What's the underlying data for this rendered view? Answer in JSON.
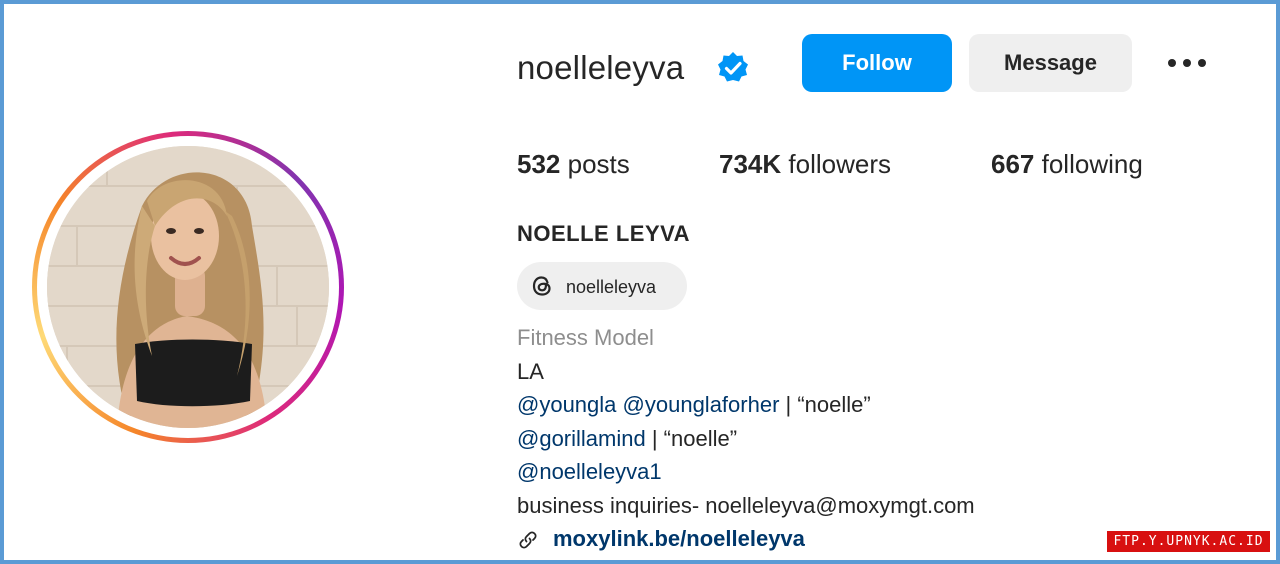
{
  "profile": {
    "username": "noelleleyva",
    "verified_icon": "verified-badge-icon",
    "follow_label": "Follow",
    "message_label": "Message",
    "more_icon": "more-options-icon"
  },
  "stats": {
    "posts_count": "532",
    "posts_label": "posts",
    "followers_count": "734K",
    "followers_label": "followers",
    "following_count": "667",
    "following_label": "following"
  },
  "bio": {
    "full_name": "NOELLE LEYVA",
    "threads_icon": "threads-icon",
    "threads_handle": "noelleleyva",
    "category": "Fitness Model",
    "location": "LA",
    "line1_mention_a": "@youngla",
    "line1_mention_b": "@younglaforher",
    "line1_rest": " | “noelle”",
    "line2_mention": "@gorillamind",
    "line2_rest": " | “noelle”",
    "line3_mention": "@noelleleyva1",
    "line4": "business inquiries- noelleleyva@moxymgt.com",
    "link_icon": "link-icon",
    "link": "moxylink.be/noelleleyva"
  },
  "watermark": "FTP.Y.UPNYK.AC.ID",
  "colors": {
    "follow_button": "#0095f6",
    "message_button": "#efefef",
    "link": "#00376b",
    "category_text": "#8e8e8e",
    "verified": "#0095f6",
    "frame_border": "#5b9bd5",
    "watermark_bg": "#d81010"
  }
}
